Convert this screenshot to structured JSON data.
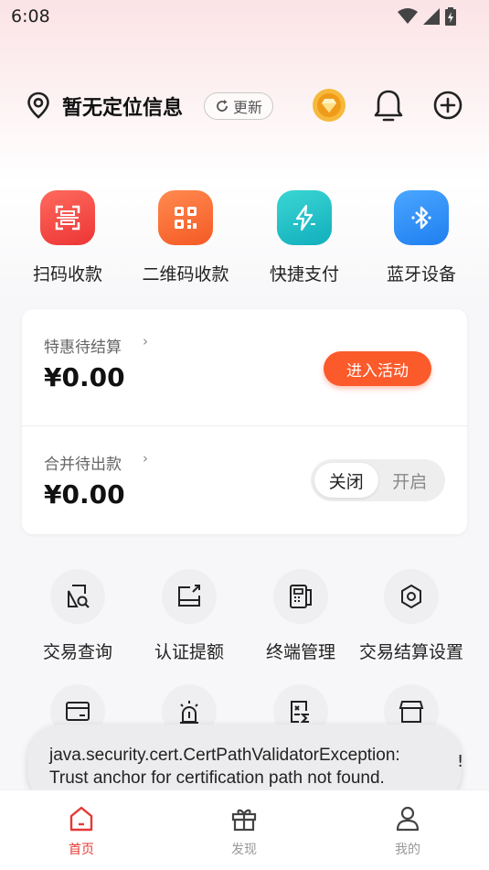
{
  "status_bar": {
    "time": "6:08"
  },
  "header": {
    "location_text": "暂无定位信息",
    "refresh_label": "更新"
  },
  "quick_actions": [
    {
      "label": "扫码收款",
      "icon": "scan-icon",
      "color": "#f2403f"
    },
    {
      "label": "二维码收款",
      "icon": "qrcode-icon",
      "color": "#f9652a"
    },
    {
      "label": "快捷支付",
      "icon": "flash-pay-icon",
      "color": "#1dbcc0"
    },
    {
      "label": "蓝牙设备",
      "icon": "bluetooth-icon",
      "color": "#2b8cf2"
    }
  ],
  "settlement_card": {
    "special": {
      "label": "特惠待结算",
      "amount": "¥0.00",
      "action_label": "进入活动"
    },
    "merged": {
      "label": "合并待出款",
      "amount": "¥0.00",
      "toggle_off": "关闭",
      "toggle_on": "开启",
      "toggle_state": "off"
    }
  },
  "services": [
    {
      "label": "交易查询",
      "icon": "transaction-query-icon"
    },
    {
      "label": "认证提额",
      "icon": "certify-limit-icon"
    },
    {
      "label": "终端管理",
      "icon": "terminal-icon"
    },
    {
      "label": "交易结算设置",
      "icon": "settlement-settings-icon"
    },
    {
      "icon": "card-icon"
    },
    {
      "icon": "alarm-icon"
    },
    {
      "icon": "bill-icon"
    },
    {
      "icon": "store-icon"
    }
  ],
  "toast": {
    "line1": "java.security.cert.CertPathValidatorException:",
    "line2": "Trust anchor for certification path not found.",
    "edge_char": "!"
  },
  "bottom_nav": [
    {
      "label": "首页",
      "icon": "home-icon",
      "active": true
    },
    {
      "label": "发现",
      "icon": "gift-icon",
      "active": false
    },
    {
      "label": "我的",
      "icon": "profile-icon",
      "active": false
    }
  ],
  "colors": {
    "accent": "#fb5a2b",
    "nav_active": "#e53935"
  }
}
